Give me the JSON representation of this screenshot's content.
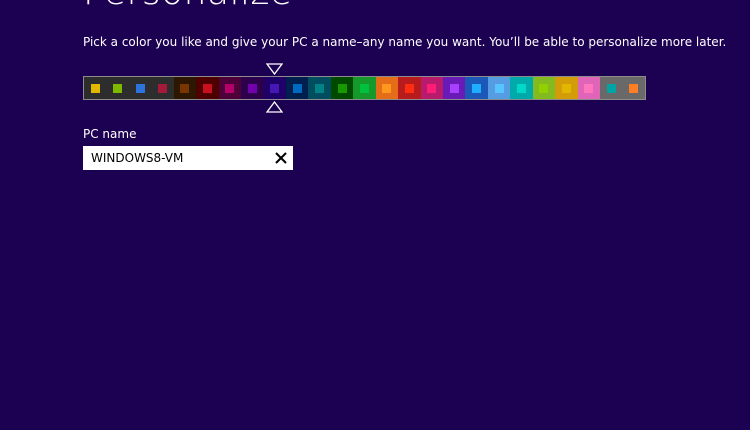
{
  "page": {
    "title": "Personalize",
    "instructions": "Pick a color you like and give your PC a name–any name you want. You’ll be able to personalize more later."
  },
  "palette": {
    "selected_index": 8,
    "swatches": [
      {
        "bg": "#2d2d2d",
        "chip": "#e1b700"
      },
      {
        "bg": "#2d2d2d",
        "chip": "#7eb900"
      },
      {
        "bg": "#2d2d2d",
        "chip": "#2d73dc"
      },
      {
        "bg": "#2d2d2d",
        "chip": "#a31b3a"
      },
      {
        "bg": "#2e1700",
        "chip": "#7a3600"
      },
      {
        "bg": "#4e0000",
        "chip": "#c8101e"
      },
      {
        "bg": "#4e0038",
        "chip": "#b5006a"
      },
      {
        "bg": "#2d004e",
        "chip": "#7200ac"
      },
      {
        "bg": "#1f0068",
        "chip": "#4617b4"
      },
      {
        "bg": "#001e4e",
        "chip": "#006ac1"
      },
      {
        "bg": "#004d60",
        "chip": "#008287"
      },
      {
        "bg": "#004a00",
        "chip": "#199900"
      },
      {
        "bg": "#15992a",
        "chip": "#00c13f"
      },
      {
        "bg": "#e56c19",
        "chip": "#ff981d"
      },
      {
        "bg": "#b81b1b",
        "chip": "#ff2e12"
      },
      {
        "bg": "#b81b6c",
        "chip": "#ff1d77"
      },
      {
        "bg": "#691bb8",
        "chip": "#aa40ff"
      },
      {
        "bg": "#1b58b8",
        "chip": "#1faeff"
      },
      {
        "bg": "#569ce3",
        "chip": "#56c5ff"
      },
      {
        "bg": "#00aaaa",
        "chip": "#00d8cc"
      },
      {
        "bg": "#83ba1f",
        "chip": "#91d100"
      },
      {
        "bg": "#d39d09",
        "chip": "#e1b700"
      },
      {
        "bg": "#e064b7",
        "chip": "#ff76bc"
      },
      {
        "bg": "#696969",
        "chip": "#00a4a4"
      },
      {
        "bg": "#696969",
        "chip": "#ff7d23"
      }
    ]
  },
  "pc_name": {
    "label": "PC name",
    "value": "WINDOWS8-VM",
    "clear_icon": "close-icon"
  }
}
